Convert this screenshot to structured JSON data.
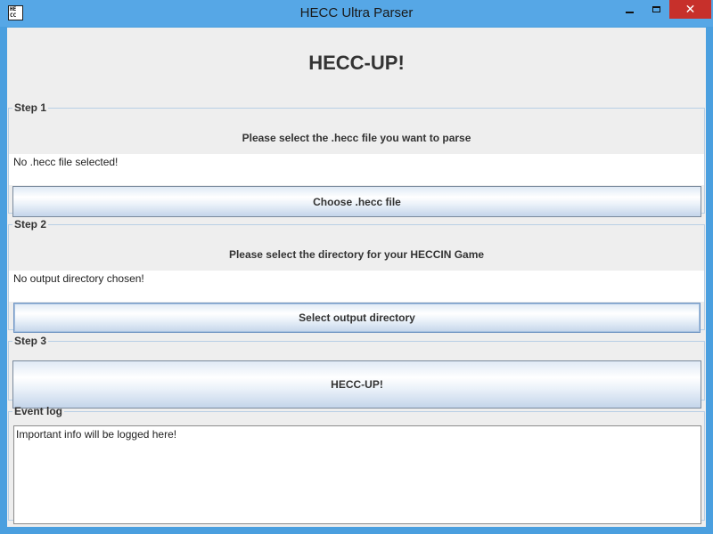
{
  "window": {
    "title": "HECC Ultra Parser",
    "icon_lines": [
      "HE",
      "CC"
    ],
    "controls": {
      "minimize": "minimize",
      "maximize": "maximize",
      "close": "✕"
    }
  },
  "app": {
    "heading": "HECC-UP!"
  },
  "step1": {
    "legend": "Step 1",
    "prompt": "Please select the .hecc file you want to parse",
    "status": "No .hecc file selected!",
    "button": "Choose .hecc file"
  },
  "step2": {
    "legend": "Step 2",
    "prompt": "Please select the directory for your HECCIN Game",
    "status": "No output directory chosen!",
    "button": "Select output directory"
  },
  "step3": {
    "legend": "Step 3",
    "button": "HECC-UP!"
  },
  "event_log": {
    "legend": "Event log",
    "text": "Important info will be logged here!"
  },
  "colors": {
    "titlebar": "#56a7e6",
    "close": "#c7302b",
    "client_bg": "#eeeeee",
    "group_border": "#b8cfe5"
  }
}
